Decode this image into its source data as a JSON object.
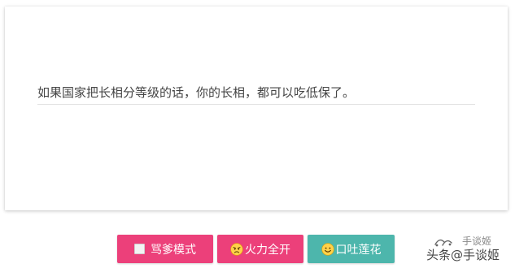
{
  "output": {
    "text": "如果国家把长相分等级的话，你的长相，都可以吃低保了。"
  },
  "buttons": {
    "curse_label": "骂爹模式",
    "fire_label": "火力全开",
    "lotus_label": "口吐莲花"
  },
  "icons": {
    "curse": "checkbox-icon",
    "fire": "angry-face-emoji",
    "lotus": "smiling-face-emoji"
  },
  "colors": {
    "pink": "#ec407a",
    "teal": "#4db6ac"
  },
  "watermark": {
    "name": "手谈姬",
    "handle": "头条@手谈姬"
  }
}
